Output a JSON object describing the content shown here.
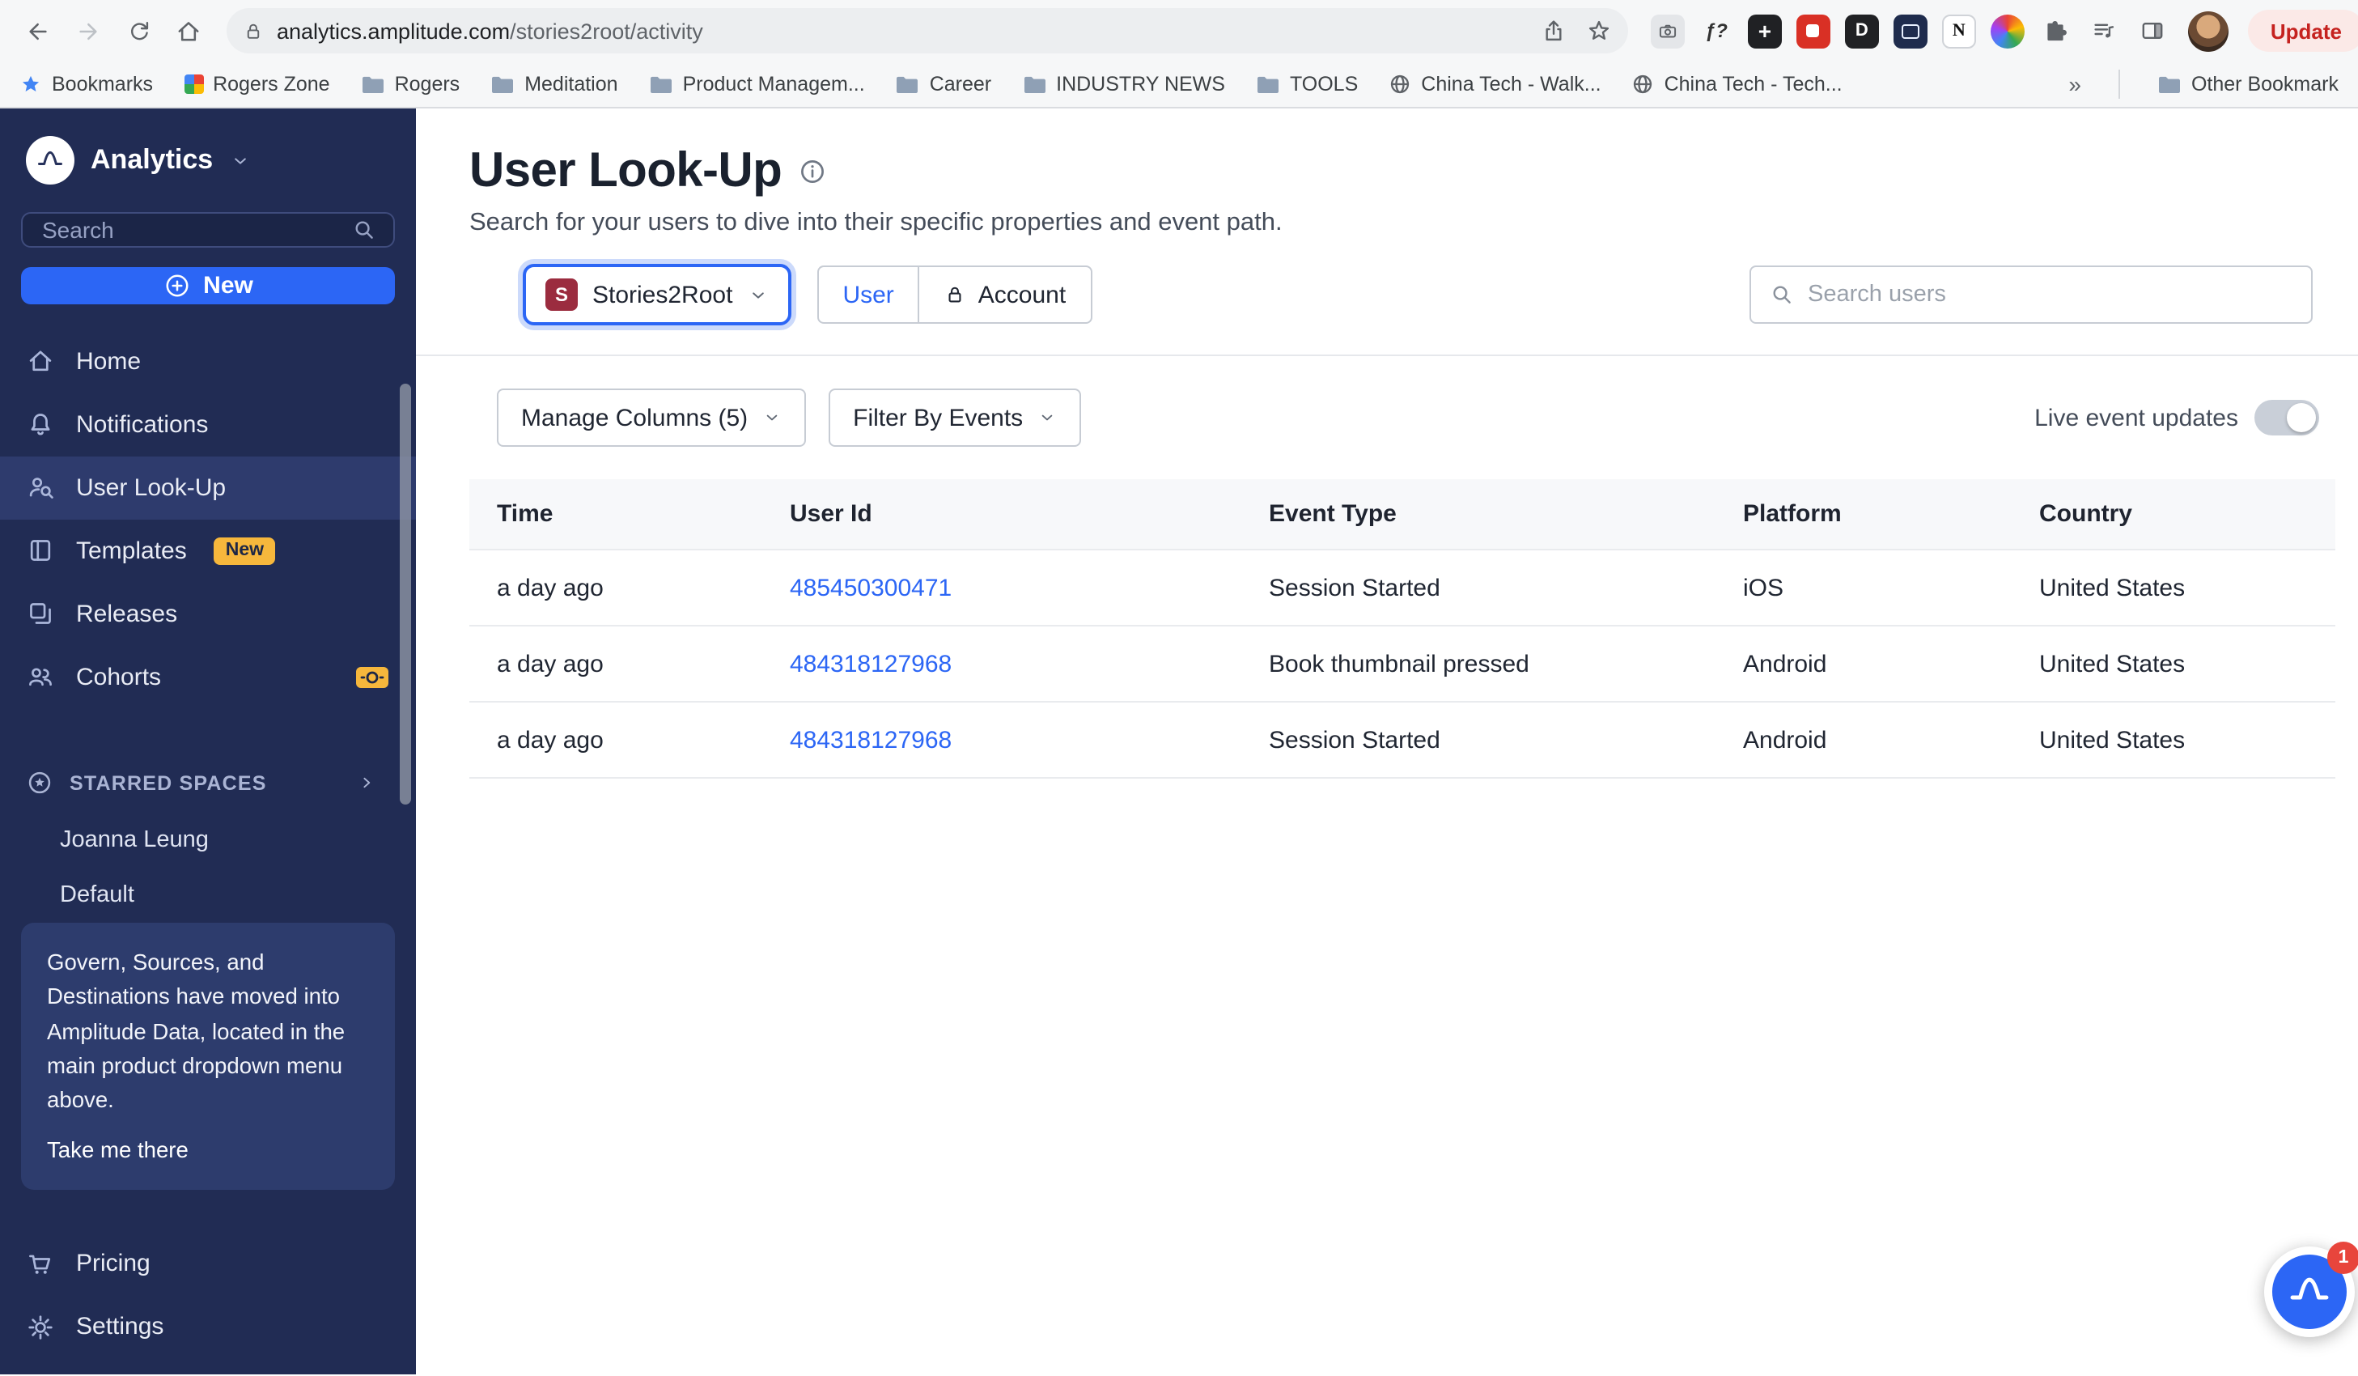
{
  "browser": {
    "url_domain": "analytics.amplitude.com",
    "url_path": "/stories2root/activity",
    "update_label": "Update",
    "overflow_chevrons": "»",
    "other_bookmarks": "Other Bookmark",
    "bookmarks": [
      {
        "label": "Bookmarks"
      },
      {
        "label": "Rogers Zone"
      },
      {
        "label": "Rogers"
      },
      {
        "label": "Meditation"
      },
      {
        "label": "Product Managem..."
      },
      {
        "label": "Career"
      },
      {
        "label": "INDUSTRY NEWS"
      },
      {
        "label": "TOOLS"
      },
      {
        "label": "China Tech - Walk..."
      },
      {
        "label": "China Tech - Tech..."
      }
    ],
    "extensions": [
      {
        "name": "screenshot-camera",
        "glyph": ""
      },
      {
        "name": "math-tool",
        "glyph": "ƒ?"
      },
      {
        "name": "plus-tool",
        "glyph": "+"
      },
      {
        "name": "red-tool",
        "glyph": ""
      },
      {
        "name": "d-tool",
        "glyph": "D"
      },
      {
        "name": "capture-tool",
        "glyph": ""
      },
      {
        "name": "notion",
        "glyph": "N"
      },
      {
        "name": "color-tool",
        "glyph": ""
      }
    ]
  },
  "sidebar": {
    "app_name": "Analytics",
    "search_placeholder": "Search",
    "new_button": "New",
    "items": [
      {
        "label": "Home"
      },
      {
        "label": "Notifications"
      },
      {
        "label": "User Look-Up"
      },
      {
        "label": "Templates",
        "badge": "New"
      },
      {
        "label": "Releases"
      },
      {
        "label": "Cohorts"
      }
    ],
    "starred_header": "STARRED SPACES",
    "starred_items": [
      {
        "label": "Joanna Leung"
      },
      {
        "label": "Default"
      }
    ],
    "notice": {
      "text": "Govern, Sources, and Destinations have moved into Amplitude Data, located in the main product dropdown menu above.",
      "link": "Take me there"
    },
    "footer": [
      {
        "label": "Pricing"
      },
      {
        "label": "Settings"
      }
    ]
  },
  "main": {
    "title": "User Look-Up",
    "subtitle": "Search for your users to dive into their specific properties and event path.",
    "project": {
      "initial": "S",
      "label": "Stories2Root"
    },
    "mode_user": "User",
    "mode_account": "Account",
    "search_placeholder": "Search users",
    "manage_columns": "Manage Columns (5)",
    "filter_by_events": "Filter By Events",
    "live_updates_label": "Live event updates",
    "table": {
      "headers": [
        "Time",
        "User Id",
        "Event Type",
        "Platform",
        "Country"
      ],
      "rows": [
        {
          "time": "a day ago",
          "user_id": "485450300471",
          "event_type": "Session Started",
          "platform": "iOS",
          "country": "United States"
        },
        {
          "time": "a day ago",
          "user_id": "484318127968",
          "event_type": "Book thumbnail pressed",
          "platform": "Android",
          "country": "United States"
        },
        {
          "time": "a day ago",
          "user_id": "484318127968",
          "event_type": "Session Started",
          "platform": "Android",
          "country": "United States"
        }
      ]
    }
  },
  "chat": {
    "badge": "1"
  }
}
